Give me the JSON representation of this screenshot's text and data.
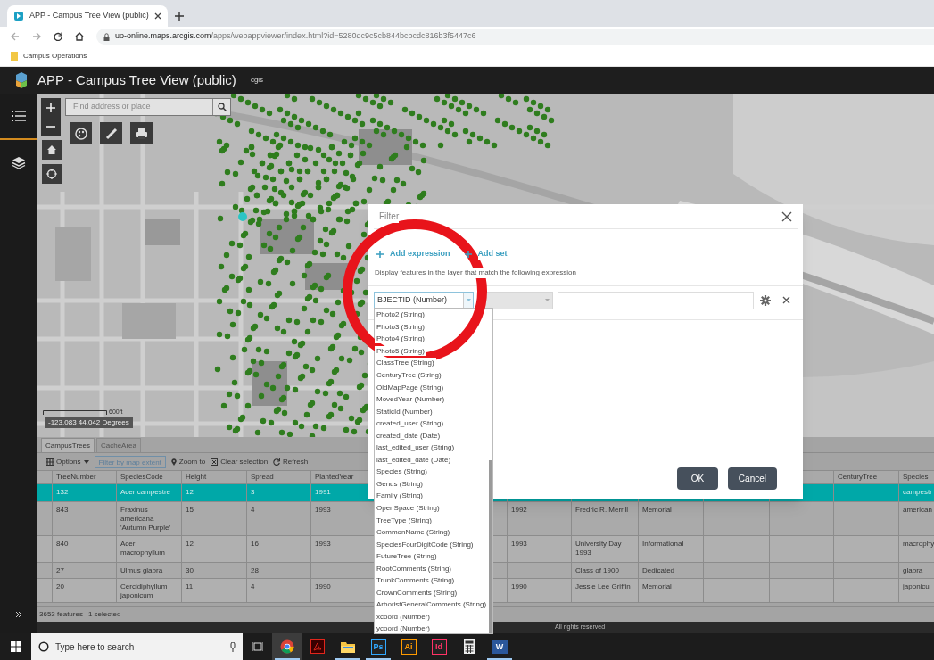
{
  "browser": {
    "tab_title": "APP - Campus Tree View (public)",
    "url_host": "uo-online.maps.arcgis.com",
    "url_path": "/apps/webappviewer/index.html?id=5280dc9c5cb844bcbcdc816b3f5447c6",
    "bookmarks": [
      "Campus Operations"
    ]
  },
  "app": {
    "title": "APP - Campus Tree View (public)",
    "user": "cgis"
  },
  "sidebar": {
    "items": [
      {
        "kind": "list",
        "selected": true
      },
      {
        "kind": "layers",
        "selected": false
      }
    ]
  },
  "map": {
    "search_placeholder": "Find address or place",
    "scale_label": "600ft",
    "coordinates": "-123.083 44.042 Degrees"
  },
  "filter_dialog": {
    "title": "Filter",
    "links": [
      "Add expression",
      "Add set"
    ],
    "description": "Display features in the layer that match the following expression",
    "field_value": "BJECTID (Number)",
    "buttons": [
      "OK",
      "Cancel"
    ],
    "field_options": [
      "Photo2 (String)",
      "Photo3 (String)",
      "Photo4 (String)",
      "Photo5 (String)",
      "ClassTree (String)",
      "CenturyTree (String)",
      "OldMapPage (String)",
      "MovedYear (Number)",
      "StaticId (Number)",
      "created_user (String)",
      "created_date (Date)",
      "last_edited_user (String)",
      "last_edited_date (Date)",
      "Species (String)",
      "Genus (String)",
      "Family (String)",
      "OpenSpace (String)",
      "TreeType (String)",
      "CommonName (String)",
      "SpeciesFourDigitCode (String)",
      "FutureTree (String)",
      "RootComments (String)",
      "TrunkComments (String)",
      "CrownComments (String)",
      "ArboristGeneralComments (String)",
      "xcoord (Number)",
      "ycoord (Number)"
    ]
  },
  "attribute_table": {
    "tabs": [
      {
        "label": "CampusTrees",
        "selected": true
      },
      {
        "label": "CacheArea",
        "selected": false
      }
    ],
    "toolbar": [
      {
        "kind": "options",
        "label": "Options"
      },
      {
        "kind": "toggle",
        "label": "Filter by map extent"
      },
      {
        "kind": "zoom",
        "label": "Zoom to"
      },
      {
        "kind": "clear",
        "label": "Clear selection"
      },
      {
        "kind": "refresh",
        "label": "Refresh"
      }
    ],
    "columns": [
      "TreeNumber",
      "SpeciesCode",
      "Height",
      "Spread",
      "PlantedYear",
      null,
      null,
      null,
      null,
      null,
      null,
      null,
      "CenturyTree",
      "Species"
    ],
    "rows": [
      {
        "selected": true,
        "cells": [
          "132",
          "Acer campestre",
          "12",
          "3",
          "1991",
          null,
          null,
          null,
          null,
          null,
          null,
          null,
          null,
          "campestr"
        ]
      },
      {
        "selected": false,
        "cells": [
          "843",
          "Fraxinus americana 'Autumn Purple'",
          "15",
          "4",
          "1993",
          null,
          null,
          "1992",
          "Fredric R. Merrill",
          "Memorial",
          null,
          null,
          null,
          "american"
        ]
      },
      {
        "selected": false,
        "cells": [
          "840",
          "Acer macrophyllum",
          "12",
          "16",
          "1993",
          null,
          null,
          "1993",
          "University Day 1993",
          "Informational",
          null,
          null,
          null,
          "macrophy"
        ]
      },
      {
        "selected": false,
        "cells": [
          "27",
          "Ulmus glabra",
          "30",
          "28",
          null,
          null,
          null,
          null,
          "Class of 1900",
          "Dedicated",
          null,
          null,
          null,
          "glabra"
        ]
      },
      {
        "selected": false,
        "cells": [
          "20",
          "Cercidiphyllum japonicum",
          "11",
          "4",
          "1990",
          null,
          null,
          "1990",
          "Jessie Lee Griffin",
          "Memorial",
          null,
          null,
          null,
          "japonicu"
        ]
      }
    ],
    "feature_count": "3653 features",
    "selection_count": "1 selected"
  },
  "footer": "All rights reserved",
  "taskbar": {
    "search_placeholder": "Type here to search",
    "apps": [
      {
        "kind": "chrome",
        "active": true,
        "running": true
      },
      {
        "kind": "pdf",
        "active": false,
        "running": false
      },
      {
        "kind": "folder",
        "active": false,
        "running": true
      },
      {
        "kind": "badge",
        "label": "Ps",
        "color": "#31a8ff",
        "active": false,
        "running": true
      },
      {
        "kind": "badge",
        "label": "Ai",
        "color": "#ff9a00",
        "active": false,
        "running": false
      },
      {
        "kind": "badge",
        "label": "Id",
        "color": "#ff3366",
        "active": false,
        "running": false
      },
      {
        "kind": "calculator",
        "active": false,
        "running": false
      },
      {
        "kind": "word",
        "label": "W",
        "active": false,
        "running": true
      }
    ]
  }
}
